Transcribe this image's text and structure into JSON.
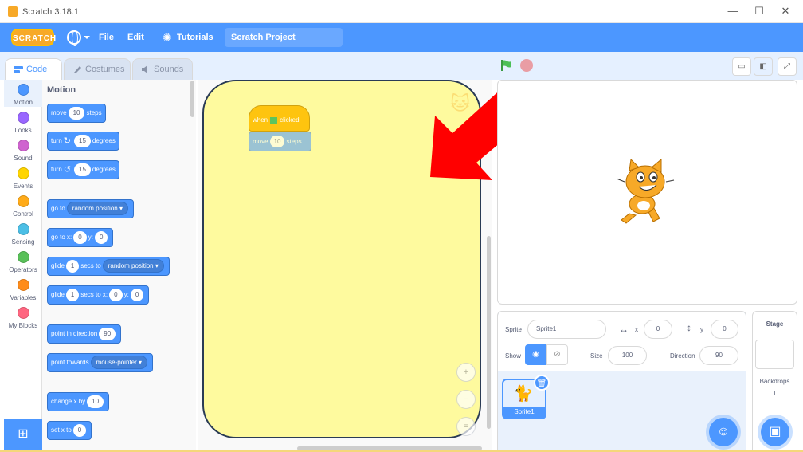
{
  "window": {
    "title": "Scratch 3.18.1",
    "minimize": "—",
    "maximize": "☐",
    "close": "✕"
  },
  "menubar": {
    "logo": "SCRATCH",
    "file": "File",
    "edit": "Edit",
    "tutorials": "Tutorials",
    "project_title": "Scratch Project"
  },
  "tabs": {
    "code": "Code",
    "costumes": "Costumes",
    "sounds": "Sounds"
  },
  "categories": [
    {
      "label": "Motion",
      "color": "#4c97ff"
    },
    {
      "label": "Looks",
      "color": "#9966ff"
    },
    {
      "label": "Sound",
      "color": "#cf63cf"
    },
    {
      "label": "Events",
      "color": "#ffd500"
    },
    {
      "label": "Control",
      "color": "#ffab19"
    },
    {
      "label": "Sensing",
      "color": "#4cbfe6"
    },
    {
      "label": "Operators",
      "color": "#59c059"
    },
    {
      "label": "Variables",
      "color": "#ff8c1a"
    },
    {
      "label": "My Blocks",
      "color": "#ff6680"
    }
  ],
  "palette": {
    "heading": "Motion",
    "move": {
      "a": "move",
      "v": "10",
      "b": "steps"
    },
    "turn_r": {
      "a": "turn",
      "v": "15",
      "b": "degrees"
    },
    "turn_l": {
      "a": "turn",
      "v": "15",
      "b": "degrees"
    },
    "goto": {
      "a": "go to",
      "dd": "random position"
    },
    "gotoxy": {
      "a": "go to x:",
      "x": "0",
      "b": "y:",
      "y": "0"
    },
    "glide": {
      "a": "glide",
      "v": "1",
      "b": "secs to",
      "dd": "random position"
    },
    "glidexy": {
      "a": "glide",
      "v": "1",
      "b": "secs to x:",
      "x": "0",
      "c": "y:",
      "y": "0"
    },
    "point_dir": {
      "a": "point in direction",
      "v": "90"
    },
    "point_tow": {
      "a": "point towards",
      "dd": "mouse-pointer"
    },
    "changex": {
      "a": "change x by",
      "v": "10"
    },
    "setx": {
      "a": "set x to",
      "v": "0"
    }
  },
  "workspace": {
    "hat": {
      "a": "when",
      "b": "clicked"
    },
    "move": {
      "a": "move",
      "v": "10",
      "b": "steps"
    },
    "zoom_in": "+",
    "zoom_out": "−",
    "zoom_reset": "="
  },
  "sprite_info": {
    "sprite_label": "Sprite",
    "sprite_name": "Sprite1",
    "x_label": "x",
    "x_value": "0",
    "y_label": "y",
    "y_value": "0",
    "show_label": "Show",
    "size_label": "Size",
    "size_value": "100",
    "direction_label": "Direction",
    "direction_value": "90"
  },
  "sprite_list": [
    {
      "name": "Sprite1"
    }
  ],
  "stage_pane": {
    "title": "Stage",
    "backdrops_label": "Backdrops",
    "backdrops_count": "1"
  },
  "colors": {
    "accent": "#4c97ff",
    "workspace_highlight": "#fefa9e",
    "arrow": "#ff0000"
  }
}
